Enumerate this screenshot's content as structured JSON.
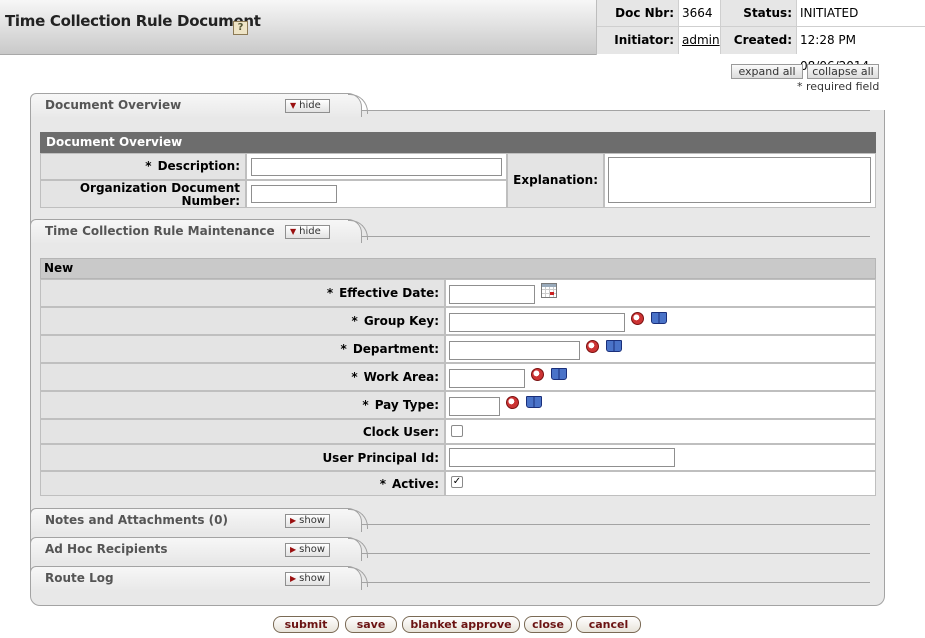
{
  "header": {
    "title": "Time Collection Rule Document",
    "help_icon": "?",
    "doc_nbr_label": "Doc Nbr:",
    "doc_nbr": "3664",
    "status_label": "Status:",
    "status": "INITIATED",
    "initiator_label": "Initiator:",
    "initiator": "admin",
    "created_label": "Created:",
    "created": "12:28 PM 08/06/2014"
  },
  "controls": {
    "expand_all": "expand all",
    "collapse_all": "collapse all",
    "required_note": "* required field"
  },
  "document_overview": {
    "tab_title": "Document Overview",
    "toggle": "hide",
    "section_title": "Document Overview",
    "description_label": "Description:",
    "description_value": "",
    "org_doc_number_label": "Organization Document Number:",
    "org_doc_number_value": "",
    "explanation_label": "Explanation:",
    "explanation_value": "",
    "required_marker": "*"
  },
  "maintenance": {
    "tab_title": "Time Collection Rule Maintenance",
    "toggle": "hide",
    "section_title": "New",
    "required_marker": "*",
    "fields": [
      {
        "label": "Effective Date:",
        "required": true,
        "value": ""
      },
      {
        "label": "Group Key:",
        "required": true,
        "value": ""
      },
      {
        "label": "Department:",
        "required": true,
        "value": ""
      },
      {
        "label": "Work Area:",
        "required": true,
        "value": ""
      },
      {
        "label": "Pay Type:",
        "required": true,
        "value": ""
      },
      {
        "label": "Clock User:",
        "required": false,
        "checked": false
      },
      {
        "label": "User Principal Id:",
        "required": false,
        "value": ""
      },
      {
        "label": "Active:",
        "required": true,
        "checked": true
      }
    ]
  },
  "collapsed_tabs": [
    {
      "title": "Notes and Attachments (0)",
      "toggle": "show"
    },
    {
      "title": "Ad Hoc Recipients",
      "toggle": "show"
    },
    {
      "title": "Route Log",
      "toggle": "show"
    }
  ],
  "actions": {
    "submit": "submit",
    "save": "save",
    "blanket_approve": "blanket approve",
    "close": "close",
    "cancel": "cancel"
  },
  "icons": {
    "help": "help-icon",
    "lookup": "magnifier-lookup-icon",
    "inquiry": "book-inquiry-icon",
    "calendar": "calendar-icon",
    "toggle_hide": "triangle-down-icon",
    "toggle_show": "triangle-right-icon"
  }
}
